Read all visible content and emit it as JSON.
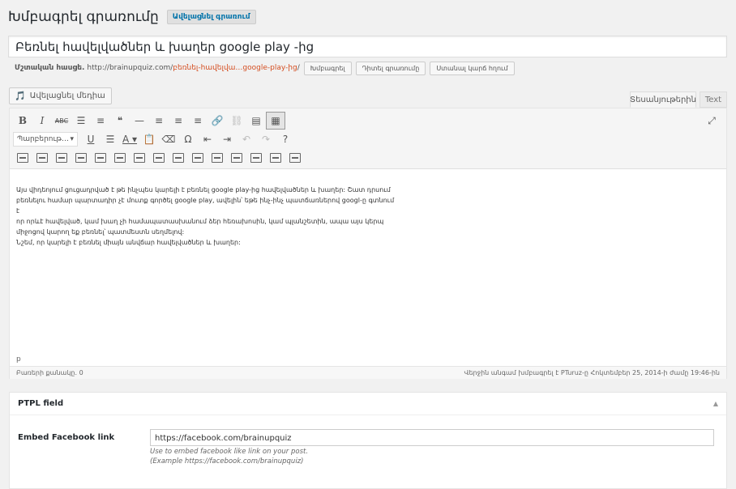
{
  "header": {
    "title": "Խմբագրել գրառումը",
    "add_new": "Ավելացնել գրառում"
  },
  "post_title": "Բեռնել հավելվածներ և խաղեր google play -ից",
  "permalink": {
    "label": "Մշտական հասցե.",
    "base": "http://brainupquiz.com/",
    "slug": "բեռնել-հավելվա…google-play-ից",
    "trail": "/",
    "edit_button": "Խմբագրել",
    "view_button": "Դիտել գրառումը",
    "shortlink_button": "Ստանալ կարճ հղում"
  },
  "media_button": {
    "label": "Ավելացնել մեդիա",
    "icon": "media-icon"
  },
  "tabs": {
    "visual": "Տեսանյութերին",
    "text": "Text"
  },
  "toolbar": {
    "row1": [
      {
        "name": "bold-button",
        "glyph": "B",
        "cls": "b"
      },
      {
        "name": "italic-button",
        "glyph": "I",
        "cls": "i"
      },
      {
        "name": "strikethrough-button",
        "glyph": "ABC",
        "cls": "small"
      },
      {
        "name": "bullet-list-button",
        "glyph": "☰",
        "cls": ""
      },
      {
        "name": "numbered-list-button",
        "glyph": "≡",
        "cls": ""
      },
      {
        "name": "blockquote-button",
        "glyph": "❝",
        "cls": ""
      },
      {
        "name": "horizontal-line-button",
        "glyph": "—",
        "cls": ""
      },
      {
        "name": "align-left-button",
        "glyph": "≡",
        "cls": ""
      },
      {
        "name": "align-center-button",
        "glyph": "≡",
        "cls": ""
      },
      {
        "name": "align-right-button",
        "glyph": "≡",
        "cls": ""
      },
      {
        "name": "insert-link-button",
        "glyph": "🔗",
        "cls": "dim"
      },
      {
        "name": "remove-link-button",
        "glyph": "⛓",
        "cls": "dim"
      },
      {
        "name": "read-more-button",
        "glyph": "▤",
        "cls": ""
      },
      {
        "name": "toolbar-toggle-button",
        "glyph": "▦",
        "cls": "active"
      }
    ],
    "format_select": "Պարբերութ…",
    "row2": [
      {
        "name": "underline-button",
        "glyph": "U",
        "cls": "u"
      },
      {
        "name": "justify-button",
        "glyph": "☰",
        "cls": ""
      },
      {
        "name": "text-color-button",
        "glyph": "A ▾",
        "cls": "u"
      },
      {
        "name": "paste-text-button",
        "glyph": "📋",
        "cls": ""
      },
      {
        "name": "clear-formatting-button",
        "glyph": "⌫",
        "cls": ""
      },
      {
        "name": "special-character-button",
        "glyph": "Ω",
        "cls": ""
      },
      {
        "name": "outdent-button",
        "glyph": "⇤",
        "cls": ""
      },
      {
        "name": "indent-button",
        "glyph": "⇥",
        "cls": ""
      },
      {
        "name": "undo-button",
        "glyph": "↶",
        "cls": "dim"
      },
      {
        "name": "redo-button",
        "glyph": "↷",
        "cls": "dim"
      },
      {
        "name": "help-button",
        "glyph": "?",
        "cls": ""
      }
    ],
    "row3_count": 15,
    "fullscreen_glyph": "⤢"
  },
  "content": {
    "lines": [
      "Այս վիդեոյում ցուցադրված է թե ինչպես կարելի է բեռնել google play-ից հավելվածներ և խաղեր: Շատ դրսում",
      "բեռնելու համար պարտադիր չէ մուտք գործել google play, ավելին՝ եթե ինչ-ինչ պատճառներով googl-ը գտնում է",
      "որ որևէ հավելված, կամ խաղ չի համապատասխանում ձեր հեռախոսին, կամ պլանշետին, ապա այս կերպ",
      "միջոցով կարող եք բեռնել՝ պատմեստն սեղմելով:",
      "Նշեմ, որ կարելի է բեռնել միայն անվճար հավելվածներ և խաղեր:"
    ]
  },
  "path": "p",
  "status": {
    "word_count": "Բառերի քանակը. 0",
    "last_edited": "Վերջին անգամ խմբագրել է PTuruz-ը Հոկտեմբեր 25, 2014-ի ժամը 19:46-ին"
  },
  "ptpl": {
    "title": "PTPL field",
    "toggle": "▲",
    "field_label": "Embed Facebook link",
    "field_value": "https://facebook.com/brainupquiz",
    "hint1": "Use to embed facebook like link on your post.",
    "hint2": "(Example https://facebook.com/brainupquiz)"
  }
}
